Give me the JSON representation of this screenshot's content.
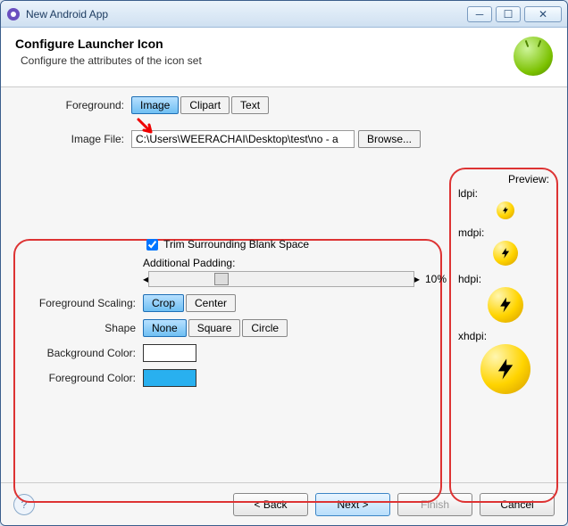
{
  "window": {
    "title": "New Android App"
  },
  "header": {
    "title": "Configure Launcher Icon",
    "subtitle": "Configure the attributes of the icon set"
  },
  "form": {
    "foreground_label": "Foreground:",
    "tabs": {
      "image": "Image",
      "clipart": "Clipart",
      "text": "Text"
    },
    "image_file_label": "Image File:",
    "image_file_value": "C:\\Users\\WEERACHAI\\Desktop\\test\\no - a",
    "browse_label": "Browse...",
    "trim_label": "Trim Surrounding Blank Space",
    "trim_checked": true,
    "padding_label": "Additional Padding:",
    "padding_pct": "10%",
    "scaling_label": "Foreground Scaling:",
    "scaling": {
      "crop": "Crop",
      "center": "Center"
    },
    "shape_label": "Shape",
    "shape": {
      "none": "None",
      "square": "Square",
      "circle": "Circle"
    },
    "bgcolor_label": "Background Color:",
    "fgcolor_label": "Foreground Color:",
    "bgcolor": "#ffffff",
    "fgcolor": "#29b0ef"
  },
  "preview": {
    "title": "Preview:",
    "ldpi": "ldpi:",
    "mdpi": "mdpi:",
    "hdpi": "hdpi:",
    "xhdpi": "xhdpi:"
  },
  "footer": {
    "back": "< Back",
    "next": "Next >",
    "finish": "Finish",
    "cancel": "Cancel"
  }
}
